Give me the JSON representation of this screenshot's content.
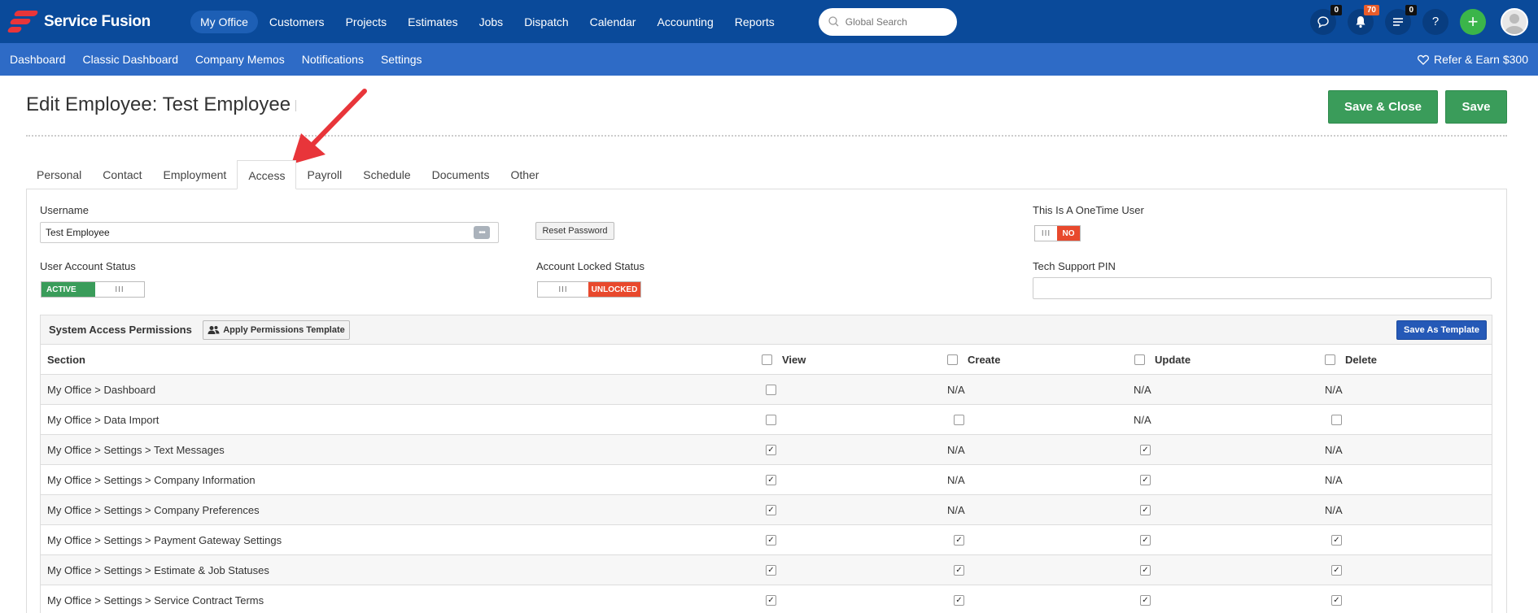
{
  "app": {
    "name": "Service Fusion"
  },
  "nav": {
    "items": [
      "My Office",
      "Customers",
      "Projects",
      "Estimates",
      "Jobs",
      "Dispatch",
      "Calendar",
      "Accounting",
      "Reports"
    ],
    "active": "My Office",
    "search_placeholder": "Global Search",
    "badges": {
      "chat": "0",
      "notifications": "70",
      "tasks": "0"
    },
    "help": "?",
    "plus": "+"
  },
  "subnav": {
    "items": [
      "Dashboard",
      "Classic Dashboard",
      "Company Memos",
      "Notifications",
      "Settings"
    ],
    "refer": "Refer & Earn $300"
  },
  "page": {
    "title": "Edit Employee: Test Employee",
    "save_close": "Save & Close",
    "save": "Save"
  },
  "tabs": [
    "Personal",
    "Contact",
    "Employment",
    "Access",
    "Payroll",
    "Schedule",
    "Documents",
    "Other"
  ],
  "active_tab": "Access",
  "form": {
    "username_label": "Username",
    "username_value": "Test Employee",
    "reset_password": "Reset Password",
    "onetime_label": "This Is A OneTime User",
    "onetime_value": "NO",
    "account_status_label": "User Account Status",
    "account_status_value": "ACTIVE",
    "locked_label": "Account Locked Status",
    "locked_value": "UNLOCKED",
    "pin_label": "Tech Support PIN",
    "pin_value": ""
  },
  "permissions": {
    "title": "System Access Permissions",
    "apply_template": "Apply Permissions Template",
    "save_template": "Save As Template",
    "columns": [
      "Section",
      "View",
      "Create",
      "Update",
      "Delete"
    ],
    "rows": [
      {
        "section": "My Office > Dashboard",
        "view": "unchecked",
        "create": "N/A",
        "update": "N/A",
        "delete": "N/A"
      },
      {
        "section": "My Office > Data Import",
        "view": "unchecked",
        "create": "unchecked",
        "update": "N/A",
        "delete": "unchecked"
      },
      {
        "section": "My Office > Settings > Text Messages",
        "view": "checked",
        "create": "N/A",
        "update": "checked",
        "delete": "N/A"
      },
      {
        "section": "My Office > Settings > Company Information",
        "view": "checked",
        "create": "N/A",
        "update": "checked",
        "delete": "N/A"
      },
      {
        "section": "My Office > Settings > Company Preferences",
        "view": "checked",
        "create": "N/A",
        "update": "checked",
        "delete": "N/A"
      },
      {
        "section": "My Office > Settings > Payment Gateway Settings",
        "view": "checked",
        "create": "checked",
        "update": "checked",
        "delete": "checked"
      },
      {
        "section": "My Office > Settings > Estimate & Job Statuses",
        "view": "checked",
        "create": "checked",
        "update": "checked",
        "delete": "checked"
      },
      {
        "section": "My Office > Settings > Service Contract Terms",
        "view": "checked",
        "create": "checked",
        "update": "checked",
        "delete": "checked"
      }
    ]
  },
  "colors": {
    "topbar": "#0a4a9a",
    "subbar": "#2e6bc6",
    "green": "#3a9c5a",
    "red": "#e8492d",
    "arrow": "#e8353a"
  }
}
